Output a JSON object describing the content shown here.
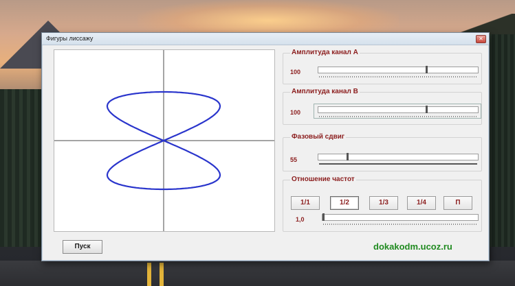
{
  "window": {
    "title": "Фигуры лиссажу",
    "close_label": "✕"
  },
  "amp_a": {
    "label": "Амплитуда канал А",
    "value": "100",
    "position": 0.68
  },
  "amp_b": {
    "label": "Амплитуда канал В",
    "value": "100",
    "position": 0.68
  },
  "phase": {
    "label": "Фазовый сдвиг",
    "value": "55",
    "position": 0.18
  },
  "ratio": {
    "label": "Отношение частот",
    "buttons": [
      "1/1",
      "1/2",
      "1/3",
      "1/4",
      "П"
    ],
    "selected": "1/2",
    "value": "1,0",
    "position": 0.0
  },
  "start_label": "Пуск",
  "site": "dokakodm.ucoz.ru",
  "colors": {
    "curve": "#2a35cc",
    "accent_text": "#8b1d1d",
    "site_text": "#1f8a1f"
  }
}
